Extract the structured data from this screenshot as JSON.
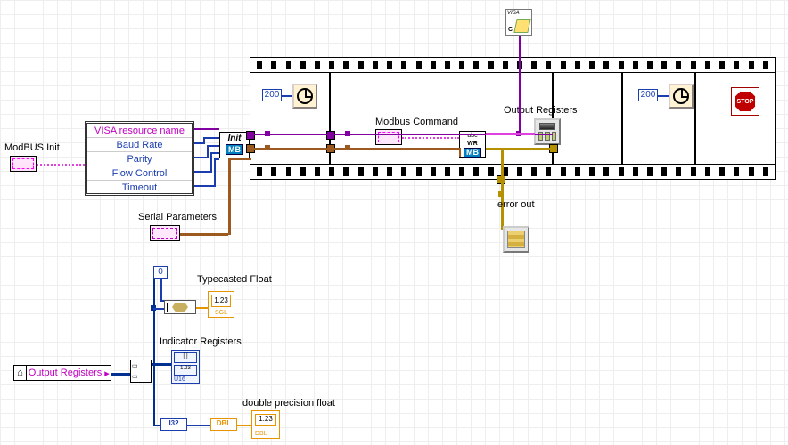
{
  "labels": {
    "modbus_init": "ModBUS Init",
    "visa_resource_name": "VISA resource name",
    "baud_rate": "Baud Rate",
    "parity": "Parity",
    "flow_control": "Flow Control",
    "timeout": "Timeout",
    "init": "Init",
    "mb": "MB",
    "serial_parameters": "Serial Parameters",
    "modbus_command": "Modbus Command",
    "output_registers": "Output Registers",
    "error_out": "error out",
    "typecasted_float": "Typecasted Float",
    "indicator_registers": "Indicator Registers",
    "double_precision_float": "double precision float",
    "output_registers_local": "Output Registers",
    "stop": "STOP",
    "wr": "WR",
    "abc": "abc"
  },
  "constants": {
    "wait1_ms": "200",
    "wait2_ms": "200",
    "index0": "0",
    "i32": "I32",
    "dbl": "DBL",
    "num123": "1.23",
    "sgl": "SGL",
    "u16": "U16",
    "visa": "VISA",
    "c": "C"
  }
}
